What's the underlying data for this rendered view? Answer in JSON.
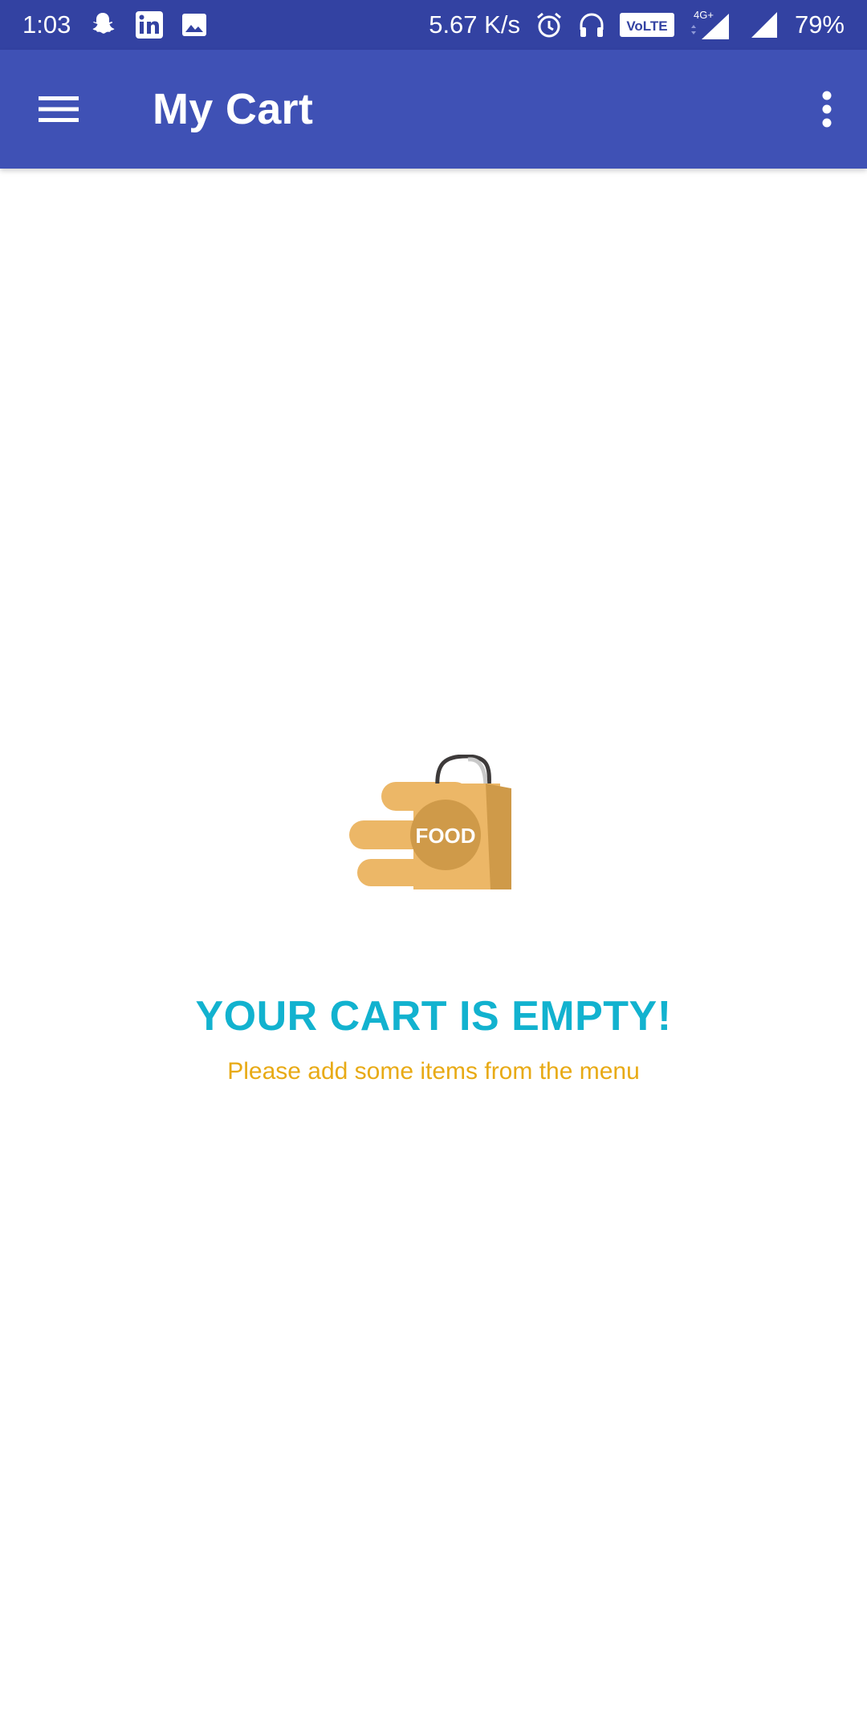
{
  "status_bar": {
    "time": "1:03",
    "network_speed": "5.67 K/s",
    "volte_label": "VoLTE",
    "network_type": "4G+",
    "battery_level": "79%",
    "left_icons": [
      "snapchat-icon",
      "linkedin-icon",
      "image-icon"
    ],
    "right_icons": [
      "alarm-icon",
      "headphones-icon",
      "volte-icon",
      "signal-icon",
      "signal-icon"
    ]
  },
  "app_bar": {
    "title": "My Cart",
    "menu_icon": "hamburger-menu-icon",
    "overflow_icon": "more-vertical-icon",
    "background_color": "#3f51b5"
  },
  "empty_state": {
    "illustration_label": "FOOD",
    "title": "YOUR CART IS EMPTY!",
    "subtitle": "Please add some items from the menu",
    "title_color": "#12b2cf",
    "subtitle_color": "#e8aa15"
  }
}
